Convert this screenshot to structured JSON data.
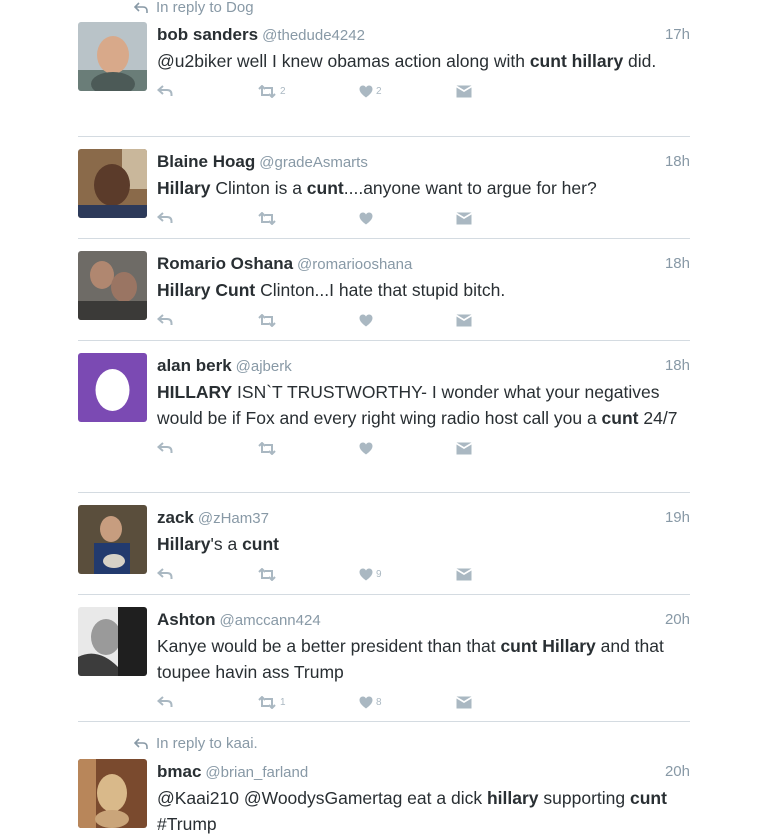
{
  "top_reply_context": "In reply to Dog",
  "tweets": [
    {
      "name": "bob sanders",
      "handle": "@thedude4242",
      "time": "17h",
      "text": [
        [
          "@u2biker well I knew obamas action along with ",
          false
        ],
        [
          "cunt hillary",
          true
        ],
        [
          " did.",
          false
        ]
      ],
      "retweets": "2",
      "likes": "2",
      "avatar_icon": "bald-man-photo"
    },
    {
      "name": "Blaine Hoag",
      "handle": "@gradeAsmarts",
      "time": "18h",
      "text": [
        [
          "Hillary",
          true
        ],
        [
          " Clinton is a ",
          false
        ],
        [
          "cunt",
          true
        ],
        [
          "....anyone want to argue for her?",
          false
        ]
      ],
      "retweets": "",
      "likes": "",
      "avatar_icon": "man-selfie-photo"
    },
    {
      "name": "Romario Oshana",
      "handle": "@romariooshana",
      "time": "18h",
      "text": [
        [
          "Hillary Cunt",
          true
        ],
        [
          " Clinton...I hate that stupid bitch.",
          false
        ]
      ],
      "retweets": "",
      "likes": "",
      "avatar_icon": "two-people-photo"
    },
    {
      "name": "alan berk",
      "handle": "@ajberk",
      "time": "18h",
      "text": [
        [
          "HILLARY",
          true
        ],
        [
          " ISN`T TRUSTWORTHY- I wonder what your negatives would be if Fox and every right wing radio host call you a ",
          false
        ],
        [
          "cunt",
          true
        ],
        [
          " 24/7",
          false
        ]
      ],
      "retweets": "",
      "likes": "",
      "avatar_icon": "default-egg-avatar"
    },
    {
      "name": "zack",
      "handle": "@zHam37",
      "time": "19h",
      "text": [
        [
          "Hillary",
          true
        ],
        [
          "'s a ",
          false
        ],
        [
          "cunt",
          true
        ]
      ],
      "retweets": "",
      "likes": "9",
      "avatar_icon": "man-holding-cat-photo"
    },
    {
      "name": "Ashton",
      "handle": "@amccann424",
      "time": "20h",
      "text": [
        [
          "Kanye would be a better president than that ",
          false
        ],
        [
          "cunt Hillary",
          true
        ],
        [
          " and that toupee havin ass Trump",
          false
        ]
      ],
      "retweets": "1",
      "likes": "8",
      "avatar_icon": "couple-bw-photo"
    }
  ],
  "bottom_reply_context": "In reply to kaai.",
  "last_tweet": {
    "name": "bmac",
    "handle": "@brian_farland",
    "time": "20h",
    "text": [
      [
        "@Kaai210 @WoodysGamertag eat a dick ",
        false
      ],
      [
        "hillary",
        true
      ],
      [
        " supporting ",
        false
      ],
      [
        "cunt",
        true
      ],
      [
        " #Trump",
        false
      ]
    ],
    "avatar_icon": "dog-photo"
  },
  "colors": {
    "text": "#292f33",
    "muted": "#8899a6",
    "icon": "#aab8c2",
    "divider": "#d4dbe1",
    "egg_bg": "#7b4ab3"
  },
  "icons": {
    "reply": "reply-icon",
    "retweet": "retweet-icon",
    "like": "heart-icon",
    "message": "envelope-icon"
  }
}
